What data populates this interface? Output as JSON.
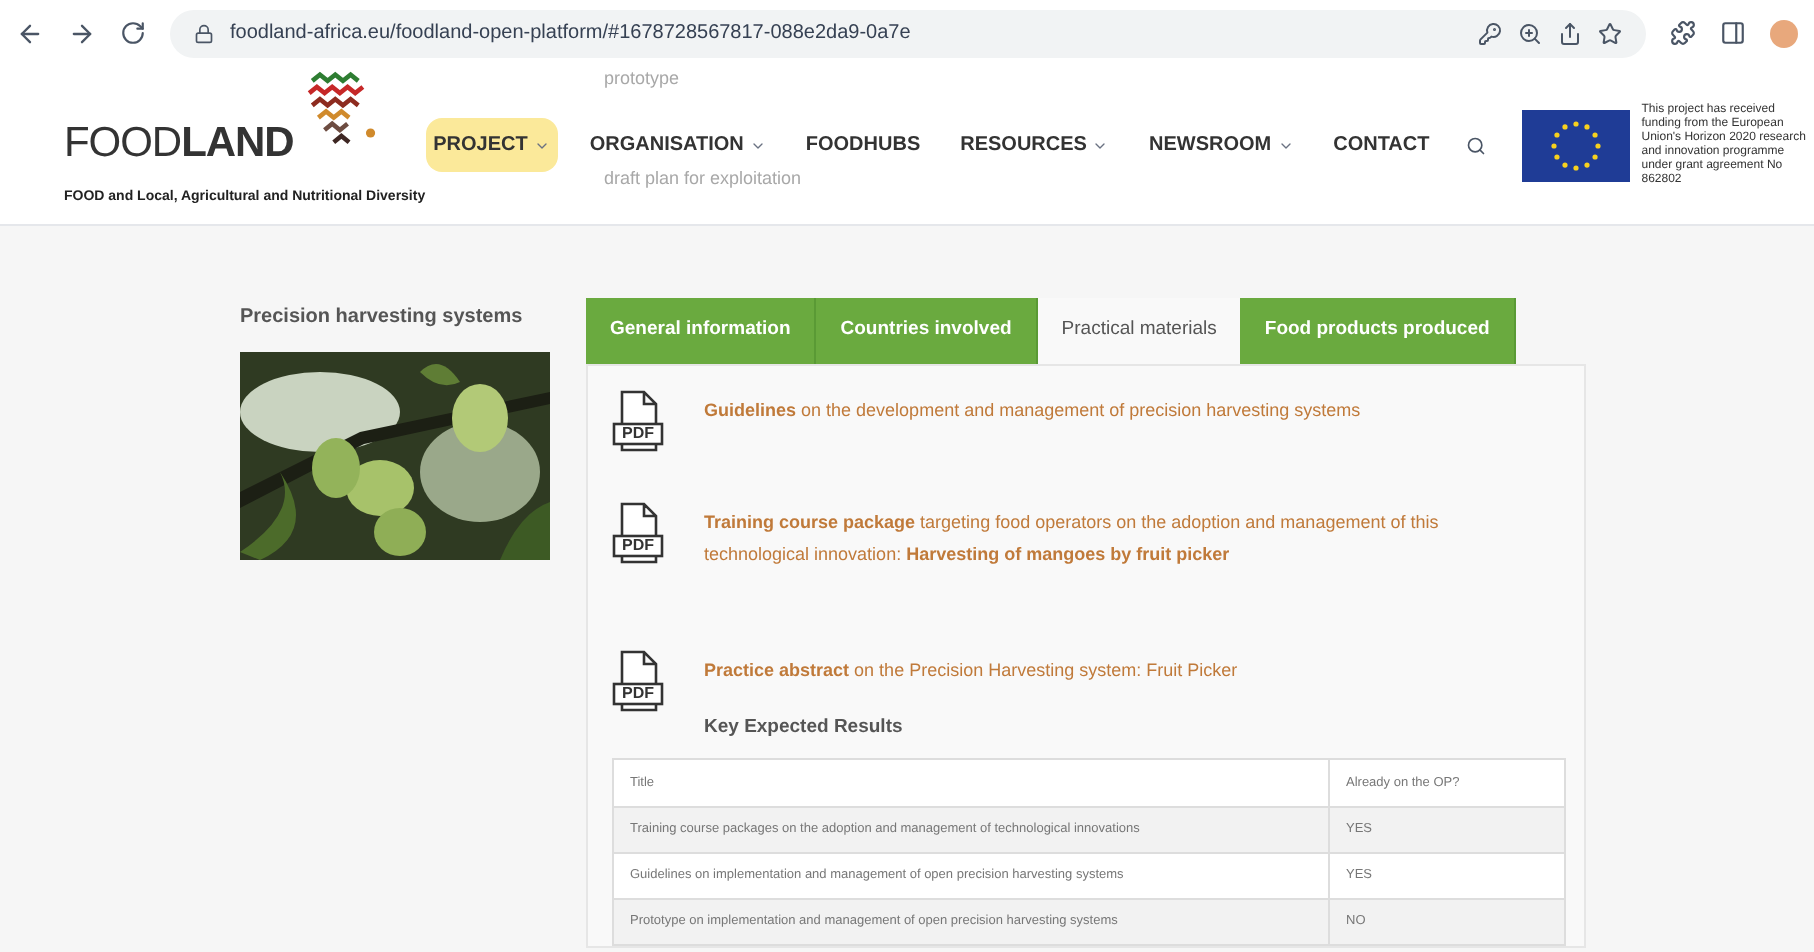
{
  "browser": {
    "url": "foodland-africa.eu/foodland-open-platform/#1678728567817-088e2da9-0a7e"
  },
  "header": {
    "logo_text_light": "FOOD",
    "logo_text_bold": "LAND",
    "tagline": "FOOD and Local, Agricultural and Nutritional Diversity",
    "ghost_items": [
      "prototype",
      "draft plan for exploitation"
    ],
    "nav": [
      {
        "label": "PROJECT",
        "dropdown": true,
        "selected": true
      },
      {
        "label": "ORGANISATION",
        "dropdown": true,
        "selected": false
      },
      {
        "label": "FOODHUBS",
        "dropdown": false,
        "selected": false
      },
      {
        "label": "RESOURCES",
        "dropdown": true,
        "selected": false
      },
      {
        "label": "NEWSROOM",
        "dropdown": true,
        "selected": false
      },
      {
        "label": "CONTACT",
        "dropdown": false,
        "selected": false
      }
    ],
    "funding": "This project has received funding from the European Union's Horizon 2020 research and innovation programme under grant agreement No 862802"
  },
  "sidebar": {
    "title": "Precision harvesting systems"
  },
  "tabs": [
    {
      "label": "General information",
      "selected": false
    },
    {
      "label": "Countries involved",
      "selected": false
    },
    {
      "label": "Practical materials",
      "selected": true
    },
    {
      "label": "Food products produced",
      "selected": false
    }
  ],
  "materials": [
    {
      "icon": "PDF",
      "text": "**Guidelines** on the development and management of precision harvesting systems"
    },
    {
      "icon": "PDF",
      "text": "**Training course package** targeting food operators on the adoption and management of this technological innovation: **Harvesting of mangoes by fruit picker**"
    },
    {
      "icon": "PDF",
      "text": "**Practice abstract** on the Precision Harvesting system: Fruit Picker"
    }
  ],
  "results": {
    "title": "Key Expected Results",
    "columns": [
      "Title",
      "Already on the OP?"
    ],
    "rows": [
      [
        "Training course packages on the adoption and management of technological innovations",
        "YES"
      ],
      [
        "Guidelines on implementation and management of open precision harvesting systems",
        "YES"
      ],
      [
        "Prototype on implementation and management of open precision harvesting systems",
        "NO"
      ]
    ]
  }
}
